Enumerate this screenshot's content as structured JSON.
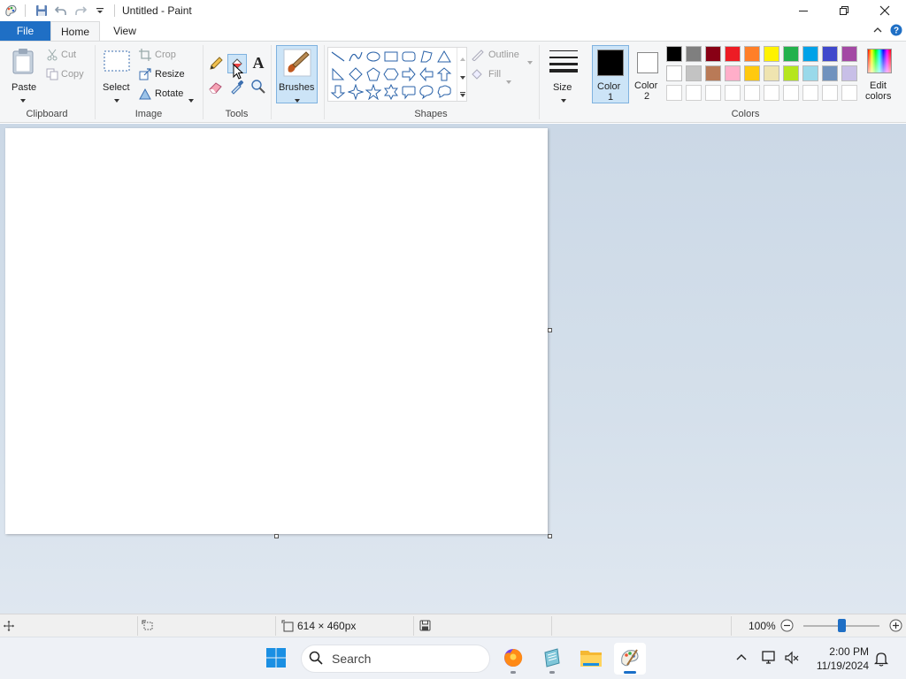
{
  "titlebar": {
    "app_title": "Untitled - Paint",
    "quick_access": [
      "paint-logo",
      "save",
      "undo",
      "redo",
      "customize"
    ]
  },
  "tabs": {
    "file": "File",
    "home": "Home",
    "view": "View"
  },
  "ribbon": {
    "clipboard": {
      "paste": "Paste",
      "cut": "Cut",
      "copy": "Copy",
      "group": "Clipboard"
    },
    "image": {
      "select": "Select",
      "crop": "Crop",
      "resize": "Resize",
      "rotate": "Rotate",
      "group": "Image"
    },
    "tools": {
      "group": "Tools",
      "text_glyph": "A"
    },
    "brushes": {
      "label": "Brushes"
    },
    "shapes": {
      "outline": "Outline",
      "fill": "Fill",
      "group": "Shapes"
    },
    "size": {
      "label": "Size"
    },
    "colors": {
      "color1": "Color",
      "color1_num": "1",
      "color2": "Color",
      "color2_num": "2",
      "edit_line1": "Edit",
      "edit_line2": "colors",
      "group": "Colors",
      "color1_value": "#000000",
      "color2_value": "#ffffff",
      "palette_row1": [
        "#000000",
        "#7f7f7f",
        "#880015",
        "#ed1c24",
        "#ff7f27",
        "#fff200",
        "#22b14c",
        "#00a2e8",
        "#3f48cc",
        "#a349a4"
      ],
      "palette_row2": [
        "#ffffff",
        "#c3c3c3",
        "#b97a57",
        "#ffaec9",
        "#ffc90e",
        "#efe4b0",
        "#b5e61d",
        "#99d9ea",
        "#7092be",
        "#c8bfe7"
      ],
      "palette_row3": [
        "#ffffff",
        "#ffffff",
        "#ffffff",
        "#ffffff",
        "#ffffff",
        "#ffffff",
        "#ffffff",
        "#ffffff",
        "#ffffff",
        "#ffffff"
      ]
    }
  },
  "statusbar": {
    "canvas_size": "614 × 460px",
    "zoom": "100%",
    "zoom_fraction": 0.5
  },
  "taskbar": {
    "search_placeholder": "Search",
    "time": "2:00 PM",
    "date": "11/19/2024"
  },
  "theme": {
    "accent": "#1f6fc5",
    "ribbon_bg": "#f5f6f7",
    "workspace": "#cbd8e6"
  }
}
